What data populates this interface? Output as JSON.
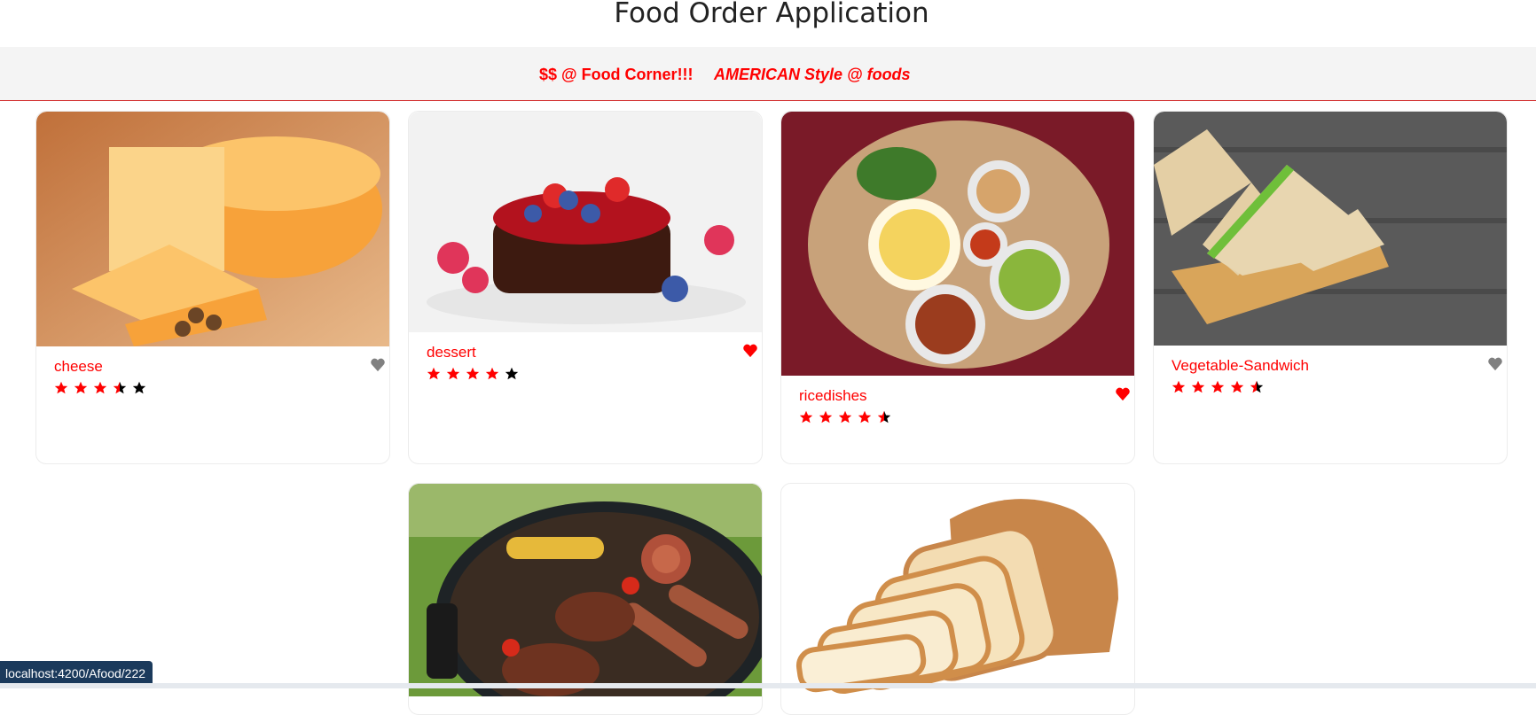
{
  "header": {
    "title": "Food Order Application"
  },
  "nav": {
    "brand": "$$ @ Food Corner!!!",
    "style_link": "AMERICAN Style @ foods"
  },
  "colors": {
    "accent": "#ff0000",
    "fav_on": "#ff0000",
    "fav_off": "#808080",
    "star_on": "#ff0000",
    "star_off": "#000000"
  },
  "foods": [
    {
      "name": "cheese",
      "rating": 3.5,
      "favorite": false
    },
    {
      "name": "dessert",
      "rating": 4,
      "favorite": true
    },
    {
      "name": "ricedishes",
      "rating": 4.5,
      "favorite": true
    },
    {
      "name": "Vegetable-Sandwich",
      "rating": 4.5,
      "favorite": false
    },
    {
      "name": "",
      "rating": null,
      "favorite": null
    },
    {
      "name": "",
      "rating": null,
      "favorite": null
    }
  ],
  "status": {
    "url": "localhost:4200/Afood/222"
  }
}
